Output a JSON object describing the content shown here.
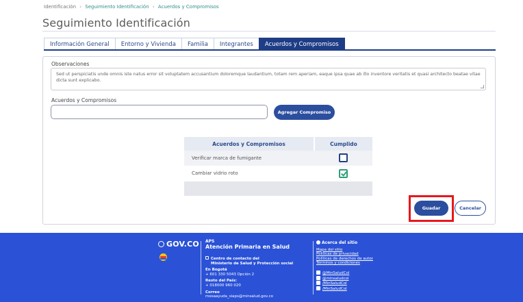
{
  "breadcrumb": {
    "items": [
      "Identificación",
      "Seguimiento Identificación",
      "Acuerdos y Compromisos"
    ],
    "separator": "›"
  },
  "page": {
    "title": "Seguimiento Identificación"
  },
  "tabs": [
    {
      "label": "Información General",
      "active": false
    },
    {
      "label": "Entorno y Vivienda",
      "active": false
    },
    {
      "label": "Familia",
      "active": false
    },
    {
      "label": "Integrantes",
      "active": false
    },
    {
      "label": "Acuerdos y Compromisos",
      "active": true
    }
  ],
  "form": {
    "observaciones_label": "Observaciones",
    "observaciones_text": "Sed ut perspiciatis unde omnis iste natus error sit voluptatem accusantium doloremque laudantium, totam rem aperiam, eaque ipsa quae ab illo inventore veritatis et quasi architecto beatae vitae dicta sunt explicabo.",
    "acuerdos_label": "Acuerdos y Compromisos",
    "acuerdos_value": "",
    "add_button": "Agregar Compromiso"
  },
  "table": {
    "headers": [
      "Acuerdos y Compromisos",
      "Cumplido"
    ],
    "rows": [
      {
        "text": "Verificar marca de fumigante",
        "checked": false
      },
      {
        "text": "Cambiar vidrio roto",
        "checked": true
      }
    ]
  },
  "actions": {
    "save": "Guadar",
    "cancel": "Cancelar"
  },
  "footer": {
    "govco": "GOV.CO",
    "aps_small": "APS",
    "aps_title": "Atención Primaria en Salud",
    "contact_title_1": "Centro de contacto del",
    "contact_title_2": "Ministerio de Salud y Protección social",
    "bogota_label": "En Bogotá",
    "bogota_phone": "+ 601 330 5043 Opción 2",
    "resto_label": "Resto del País:",
    "resto_phone": "+ 018000 960 020",
    "correo_label": "Correo",
    "correo_value": "mesaayuda_siaps@minsalud.gov.co",
    "about_title": "Acerca del sitio",
    "about_links": [
      "Mapa del sitio",
      "Políticas de privacidad",
      "Políticas de derechos de autor",
      "Términos y condiciones"
    ],
    "social": [
      "@MinSaludCol",
      "@minsaludcol",
      "/MinSaludCol",
      "/MinSaludCol"
    ]
  },
  "colors": {
    "primary": "#1e3d86",
    "button": "#2c4e9f",
    "footer_bg": "#2b52d6",
    "highlight": "#e8161d",
    "check_green": "#2e9e78"
  }
}
